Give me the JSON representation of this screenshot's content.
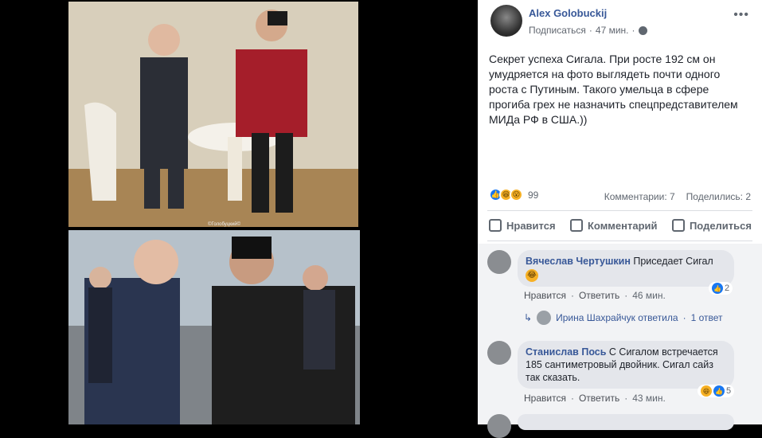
{
  "photo": {
    "watermark": "©Голобуцкий©"
  },
  "post": {
    "author": "Alex Golobuckij",
    "subscribe": "Подписаться",
    "time": "47 мин.",
    "text": "Секрет успеха Сигала. При росте 192 см он умудряется на фото выглядеть почти одного роста с Путиным. Такого умельца в сфере прогиба грех не назначить спецпредставителем МИДа РФ в США.))",
    "reaction_count": "99",
    "comments_count": "Комментарии: 7",
    "shares_count": "Поделились: 2"
  },
  "actions": {
    "like": "Нравится",
    "comment": "Комментарий",
    "share": "Поделиться"
  },
  "comments": [
    {
      "name": "Вячеслав Чертушкин",
      "text": "Приседает Сигал",
      "like": "Нравится",
      "reply": "Ответить",
      "time": "46 мин.",
      "reactions": "2",
      "reply_author": "Ирина Шахрайчук ответила",
      "reply_count": "1 ответ"
    },
    {
      "name": "Станислав Пось",
      "text": "С Сигалом встречается 185 сантиметровый двойник. Сигал сайз так сказать.",
      "like": "Нравится",
      "reply": "Ответить",
      "time": "43 мин.",
      "reactions": "5"
    }
  ],
  "icons": {
    "more": "more-icon",
    "globe": "globe-icon"
  }
}
